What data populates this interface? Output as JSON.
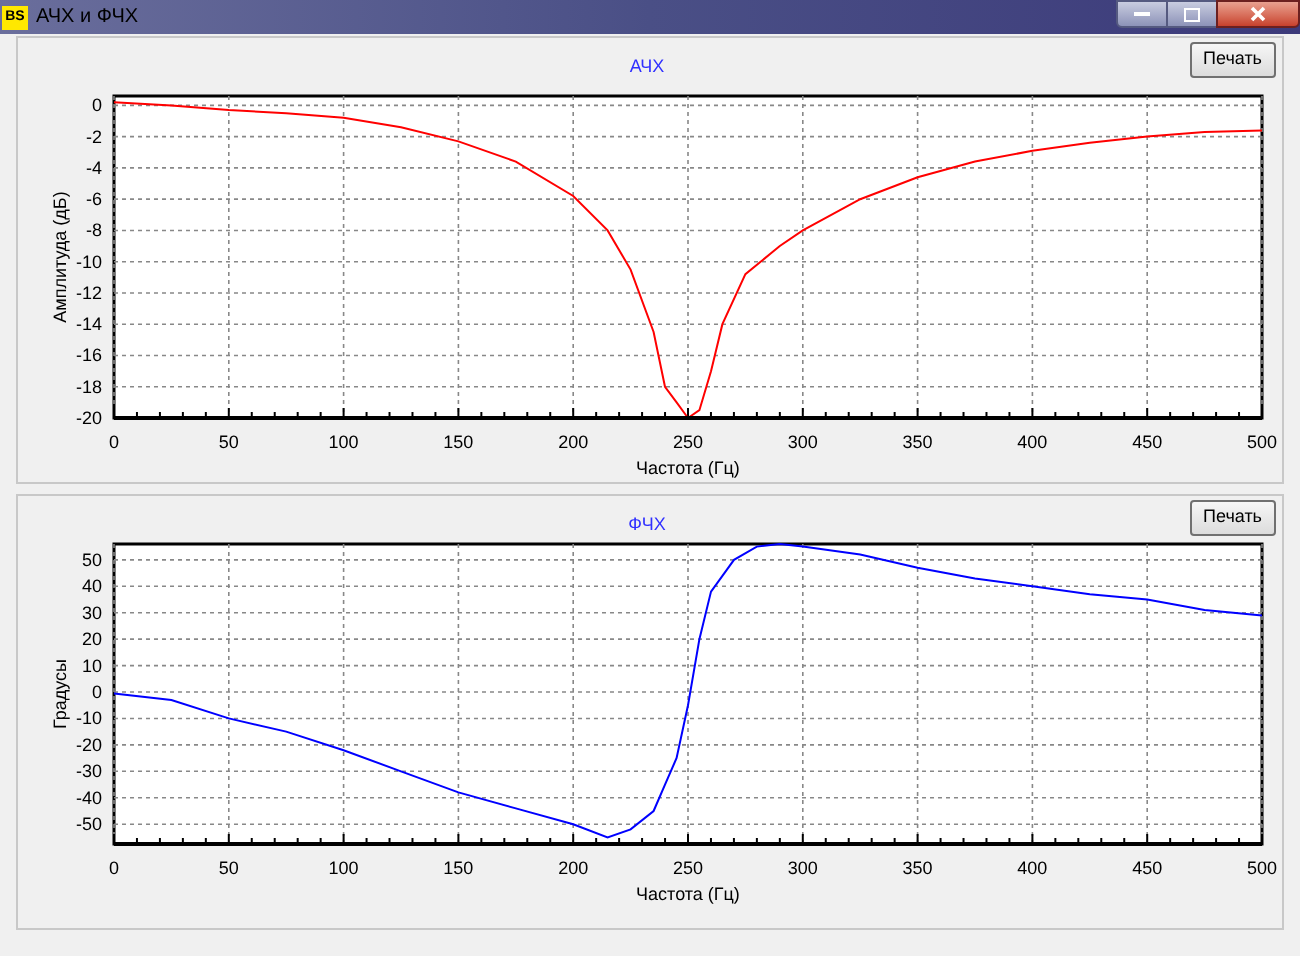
{
  "window": {
    "title": "АЧХ и ФЧХ",
    "app_badge": "BS"
  },
  "panels": [
    {
      "print_button": "Печать",
      "chart_data": {
        "type": "line",
        "title": "АЧХ",
        "xlabel": "Частота (Гц)",
        "ylabel": "Амплитуда (дБ)",
        "xlim": [
          0,
          500
        ],
        "ylim": [
          -20,
          0.6
        ],
        "xticks": [
          0,
          50,
          100,
          150,
          200,
          250,
          300,
          350,
          400,
          450,
          500
        ],
        "yticks": [
          0,
          -2,
          -4,
          -6,
          -8,
          -10,
          -12,
          -14,
          -16,
          -18,
          -20
        ],
        "x": [
          0,
          25,
          50,
          75,
          100,
          125,
          150,
          175,
          200,
          215,
          225,
          235,
          240,
          245,
          250,
          255,
          260,
          265,
          275,
          290,
          300,
          325,
          350,
          375,
          400,
          425,
          450,
          475,
          500
        ],
        "grid": true,
        "series": [
          {
            "color": "#ff0000",
            "values": [
              0.2,
              0,
              -0.3,
              -0.5,
              -0.8,
              -1.4,
              -2.3,
              -3.6,
              -5.8,
              -8,
              -10.5,
              -14.5,
              -18,
              -19,
              -20,
              -19.5,
              -17,
              -14,
              -10.8,
              -9,
              -8,
              -6,
              -4.6,
              -3.6,
              -2.9,
              -2.4,
              -2,
              -1.7,
              -1.6
            ]
          }
        ]
      }
    },
    {
      "print_button": "Печать",
      "chart_data": {
        "type": "line",
        "title": "ФЧХ",
        "xlabel": "Частота (Гц)",
        "ylabel": "Градусы",
        "xlim": [
          0,
          500
        ],
        "ylim": [
          -57.5,
          56
        ],
        "xticks": [
          0,
          50,
          100,
          150,
          200,
          250,
          300,
          350,
          400,
          450,
          500
        ],
        "yticks": [
          50,
          40,
          30,
          20,
          10,
          0,
          -10,
          -20,
          -30,
          -40,
          -50
        ],
        "x": [
          0,
          25,
          50,
          75,
          100,
          125,
          150,
          175,
          200,
          215,
          225,
          235,
          240,
          245,
          250,
          255,
          260,
          270,
          280,
          290,
          300,
          325,
          350,
          375,
          400,
          425,
          450,
          475,
          500
        ],
        "grid": true,
        "series": [
          {
            "color": "#0000ff",
            "values": [
              -0.5,
              -3,
              -10,
              -15,
              -22,
              -30,
              -38,
              -44,
              -50,
              -55,
              -52,
              -45,
              -35,
              -25,
              -5,
              20,
              38,
              50,
              55,
              56,
              55,
              52,
              47,
              43,
              40,
              37,
              35,
              31,
              29
            ]
          }
        ]
      }
    }
  ]
}
